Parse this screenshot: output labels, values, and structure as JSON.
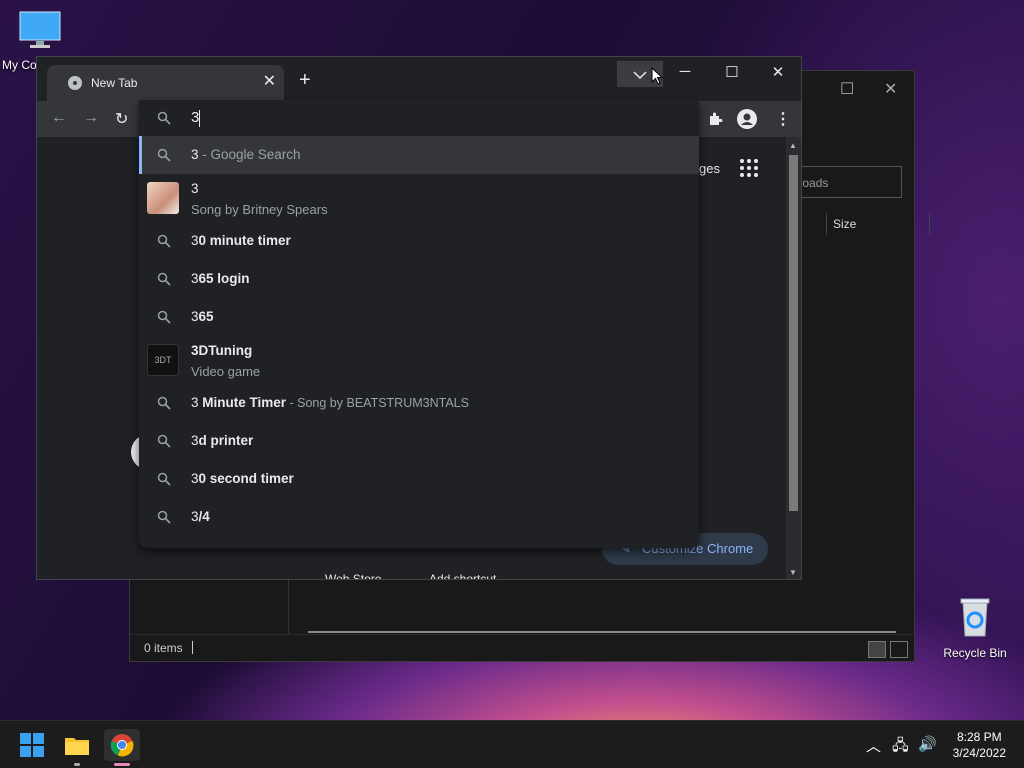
{
  "desktop": {
    "my_computer_label": "My Co",
    "recycle_bin_label": "Recycle Bin"
  },
  "explorer": {
    "search_placeholder": "nloads",
    "column_size": "Size",
    "status_items": "0 items"
  },
  "chrome": {
    "tab_title": "New Tab",
    "omnibox_query": "3",
    "images_label": "ges",
    "customize_label": "Customize Chrome",
    "shortcut_web_store": "Web Store",
    "shortcut_add": "Add shortcut",
    "suggestions": [
      {
        "bold": "3",
        "rest": " - Google Search",
        "type": "search"
      },
      {
        "bold": "3",
        "sub": "Song by Britney Spears",
        "type": "entity"
      },
      {
        "lead": "3",
        "bold": "0 minute timer",
        "type": "search"
      },
      {
        "lead": "3",
        "bold": "65 login",
        "type": "search"
      },
      {
        "lead": "3",
        "bold": "65",
        "type": "search"
      },
      {
        "lead": "3",
        "bold": "DTuning",
        "sub": "Video game",
        "type": "entity"
      },
      {
        "lead": "3",
        "bold": " Minute Timer",
        "rest": " - Song by BEATSTRUM3NTALS",
        "type": "search"
      },
      {
        "lead": "3",
        "bold": "d printer",
        "type": "search"
      },
      {
        "lead": "3",
        "bold": "0 second timer",
        "type": "search"
      },
      {
        "lead": "3",
        "bold": "/4",
        "type": "search"
      }
    ]
  },
  "taskbar": {
    "time": "8:28 PM",
    "date": "3/24/2022"
  },
  "colors": {
    "accent_blue": "#8ab4f8",
    "chrome_dark": "#202124",
    "toolbar": "#35363a"
  }
}
